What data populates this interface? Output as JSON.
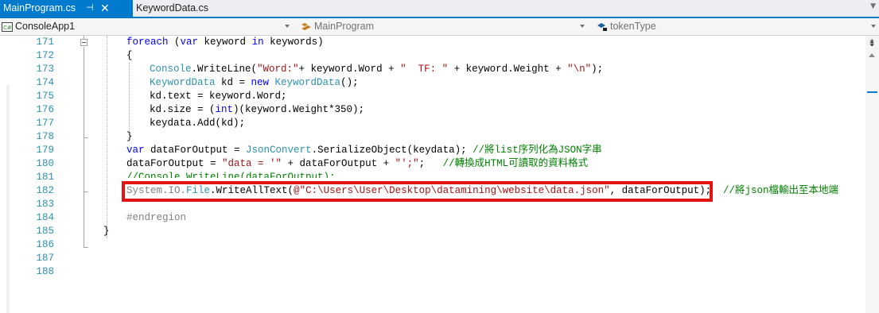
{
  "tabs": {
    "active": {
      "label": "MainProgram.cs",
      "pin": "⊣",
      "close": "✕"
    },
    "inactive": {
      "label": "KeywordData.cs"
    }
  },
  "navbar": {
    "project": "ConsoleApp1",
    "class": "MainProgram",
    "member": "tokenType"
  },
  "editor": {
    "line_numbers": [
      "171",
      "172",
      "173",
      "174",
      "175",
      "176",
      "177",
      "178",
      "179",
      "180",
      "181",
      "182",
      "183",
      "184",
      "185",
      "186",
      "187",
      "188"
    ],
    "lines": {
      "l171_kw": "foreach",
      "l171_a": " (",
      "l171_var": "var",
      "l171_b": " keyword ",
      "l171_in": "in",
      "l171_c": " keywords)",
      "l172": "{",
      "l173_type": "Console",
      "l173_a": ".WriteLine(",
      "l173_s1": "\"Word:\"",
      "l173_b": "+ keyword.Word + ",
      "l173_s2": "\"  TF: \"",
      "l173_c": " + keyword.Weight + ",
      "l173_s3": "\"\\n\"",
      "l173_d": ");",
      "l174_type1": "KeywordData",
      "l174_a": " kd = ",
      "l174_new": "new",
      "l174_type2": " KeywordData",
      "l174_b": "();",
      "l175": "kd.text = keyword.Word;",
      "l176_a": "kd.size = (",
      "l176_int": "int",
      "l176_b": ")(keyword.Weight*350);",
      "l177": "keydata.Add(kd);",
      "l178": "}",
      "l179_var": "var",
      "l179_a": " dataForOutput = ",
      "l179_type": "JsonConvert",
      "l179_b": ".SerializeObject(keydata); ",
      "l179_cmt": "//將list序列化為JSON字串",
      "l180_a": "dataForOutput = ",
      "l180_s1": "\"data = '\"",
      "l180_b": " + dataForOutput + ",
      "l180_s2": "\"';\"",
      "l180_c": ";   ",
      "l180_cmt": "//轉換成HTML可讀取的資料格式",
      "l181_cmt": "//Console.WriteLine(dataForOutput);",
      "l182_ns": "System.IO.",
      "l182_type": "File",
      "l182_a": ".WriteAllText(",
      "l182_s": "@\"C:\\Users\\User\\Desktop\\datamining\\website\\data.json\"",
      "l182_b": ", dataForOutput);",
      "l182_cmt": "//將json檔輸出至本地端",
      "l184": "#endregion",
      "l185": "}"
    }
  },
  "colors": {
    "accent": "#007acc",
    "highlight_box": "#e31414",
    "keyword": "#0000ff",
    "type": "#2b91af",
    "string": "#a31515",
    "comment": "#008000"
  }
}
